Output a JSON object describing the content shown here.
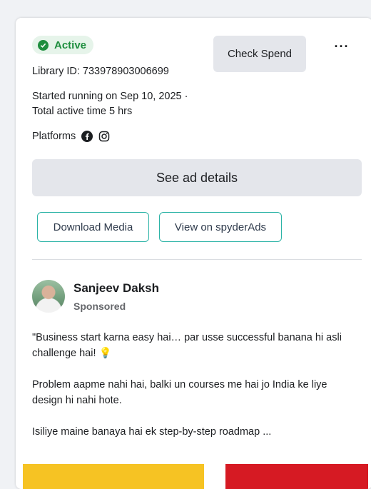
{
  "status": {
    "label": "Active",
    "color": "#1e8e3e"
  },
  "library_id": "Library ID: 733978903006699",
  "started": "Started running on Sep 10, 2025 · Total active time 5 hrs",
  "platforms": {
    "label": "Platforms",
    "icons": [
      "facebook-icon",
      "instagram-icon"
    ]
  },
  "actions": {
    "check_spend": "Check Spend",
    "more": "···",
    "see_details": "See ad details",
    "download_media": "Download Media",
    "view_spyder": "View on spyderAds"
  },
  "ad": {
    "advertiser": "Sanjeev Daksh",
    "sponsored": "Sponsored",
    "paragraphs": [
      "\"Business start karna easy hai… par usse successful banana hi asli challenge hai! 💡",
      "Problem aapme nahi hai, balki un courses me hai jo India ke liye design hi nahi hote.",
      "Isiliye maine banaya hai ek step-by-step roadmap ..."
    ]
  },
  "colors": {
    "accent_outline": "#2bb3a6",
    "banner_yellow": "#f6c323",
    "banner_red": "#d61a23"
  }
}
